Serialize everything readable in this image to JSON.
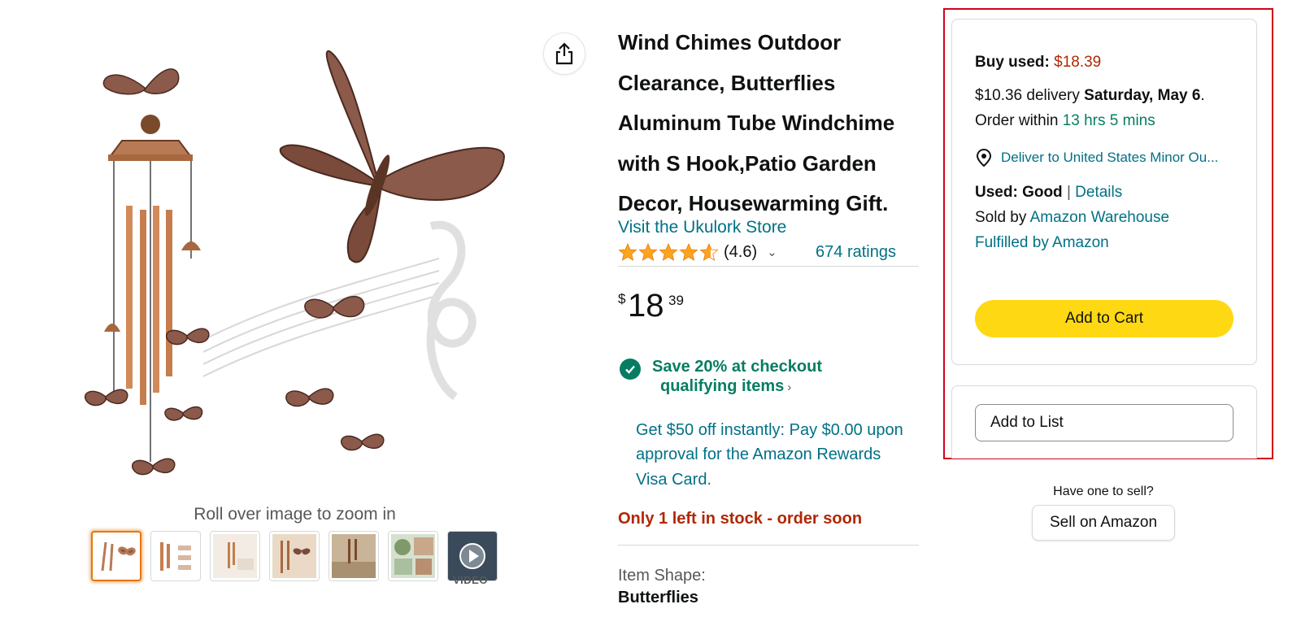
{
  "gallery": {
    "zoom_hint": "Roll over image to zoom in",
    "video_label": "VIDEO",
    "thumbnails": [
      {
        "kind": "image",
        "selected": true
      },
      {
        "kind": "image",
        "selected": false
      },
      {
        "kind": "image",
        "selected": false
      },
      {
        "kind": "image",
        "selected": false
      },
      {
        "kind": "image",
        "selected": false
      },
      {
        "kind": "image",
        "selected": false
      },
      {
        "kind": "video",
        "selected": false
      }
    ]
  },
  "share": {
    "icon": "share-icon"
  },
  "product": {
    "title": "Wind Chimes Outdoor Clearance, Butterflies Aluminum Tube Windchime with S Hook,Patio Garden Decor, Housewarming Gift.",
    "store_link": "Visit the Ukulork Store",
    "rating": {
      "value": 4.6,
      "label": "(4.6)",
      "count_label": "674 ratings"
    },
    "price": {
      "symbol": "$",
      "whole": "18",
      "fraction": "39"
    },
    "coupon": {
      "line1": "Save 20% at checkout",
      "line2": "qualifying items",
      "chevron": "›"
    },
    "promo": "Get $50 off instantly: Pay $0.00 upon approval for the Amazon Rewards Visa Card.",
    "stock": "Only 1 left in stock - order soon",
    "item_shape_label": "Item Shape:",
    "item_shape_value": "Butterflies"
  },
  "buybox": {
    "buy_used_label": "Buy used:",
    "buy_used_price": "$18.39",
    "delivery_fee": "$10.36 delivery",
    "delivery_date": "Saturday, May 6",
    "order_within_label": ". Order within",
    "order_within_time": "13 hrs 5 mins",
    "deliver_to": "Deliver to United States Minor Ou...",
    "condition_label": "Used: Good",
    "condition_sep": "|",
    "details_link": "Details",
    "sold_by_label": "Sold by",
    "sold_by_link": "Amazon Warehouse",
    "fulfilled_link": "Fulfilled by Amazon",
    "add_to_cart": "Add to Cart",
    "add_to_list": "Add to List"
  },
  "sell": {
    "question": "Have one to sell?",
    "button": "Sell on Amazon"
  },
  "colors": {
    "link": "#007185",
    "price_red": "#B12704",
    "green": "#067D62",
    "cart_yellow": "#FFD814",
    "highlight_red": "#D0021B",
    "star": "#FFA41C"
  }
}
